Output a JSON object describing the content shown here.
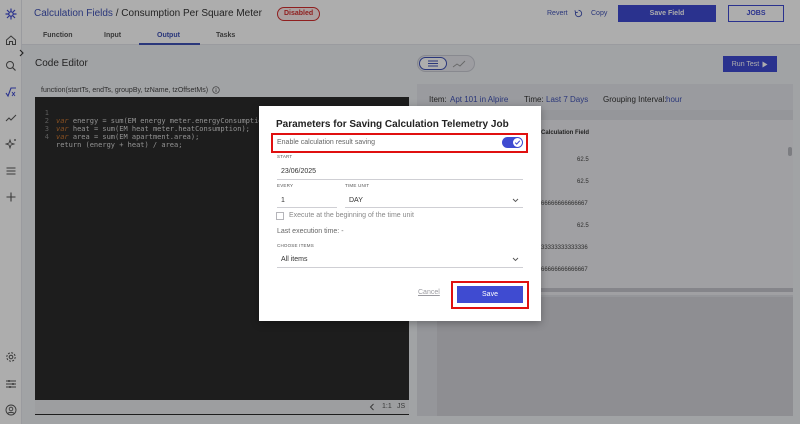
{
  "header": {
    "breadcrumb_link": "Calculation Fields",
    "breadcrumb_sep": " / ",
    "breadcrumb_current": "Consumption Per Square Meter",
    "status_badge": "Disabled",
    "revert_label": "Revert",
    "copy_label": "Copy",
    "save_field_label": "Save Field",
    "jobs_label": "JOBS"
  },
  "tabs": [
    {
      "label": "Function"
    },
    {
      "label": "Input"
    },
    {
      "label": "Output",
      "active": true
    },
    {
      "label": "Tasks"
    }
  ],
  "editor": {
    "title": "Code Editor",
    "function_signature": "function(startTs, endTs, groupBy, tzName, tzOffsetMs)",
    "lines": [
      {
        "num": "1",
        "kw": "var",
        "rest": " energy = sum(EM energy meter.energyConsumption);"
      },
      {
        "num": "2",
        "kw": "var",
        "rest": " heat = sum(EM heat meter.heatConsumption);"
      },
      {
        "num": "3",
        "kw": "var",
        "rest": " area = sum(EM apartment.area);"
      },
      {
        "num": "4",
        "kw": "",
        "rest": "return (energy + heat) / area;"
      }
    ],
    "footer_position": "1:1",
    "footer_lang": "JS"
  },
  "results": {
    "run_test_label": "Run Test",
    "item_label": "Item:",
    "item_value": "Apt 101 in Alpire",
    "time_label": "Time:",
    "time_value": "Last 7 Days",
    "grouping_label": "Grouping Interval:",
    "grouping_value": "hour",
    "column_header": "Calculation Field",
    "rows": [
      "62.5",
      "62.5",
      "66666666666667",
      "62.5",
      "33333333333336",
      "66666666666667"
    ]
  },
  "modal": {
    "title": "Parameters for Saving Calculation Telemetry Job",
    "enable_label": "Enable calculation result saving",
    "enable_checked": true,
    "start_label": "START",
    "start_value": "23/06/2025",
    "every_label": "EVERY",
    "every_value": "1",
    "time_unit_label": "TIME UNIT",
    "time_unit_value": "DAY",
    "execute_label": "Execute at the beginning of the time unit",
    "last_execution": "Last execution time: -",
    "choose_items_label": "CHOOSE ITEMS",
    "choose_items_value": "All items",
    "cancel_label": "Cancel",
    "save_label": "Save"
  },
  "colors": {
    "primary": "#3f4bd1",
    "link": "#3f51b5",
    "danger": "#d32f2f",
    "highlight": "#e01010"
  },
  "icons": [
    "logo-icon",
    "home-icon",
    "search-icon",
    "function-icon",
    "chart-icon",
    "sparkle-icon",
    "menu-icon",
    "plus-icon",
    "settings-icon",
    "sliders-icon",
    "user-icon",
    "revert-icon",
    "close-icon",
    "info-icon",
    "play-icon",
    "chevron-left-icon",
    "chevron-down-icon",
    "check-icon"
  ]
}
